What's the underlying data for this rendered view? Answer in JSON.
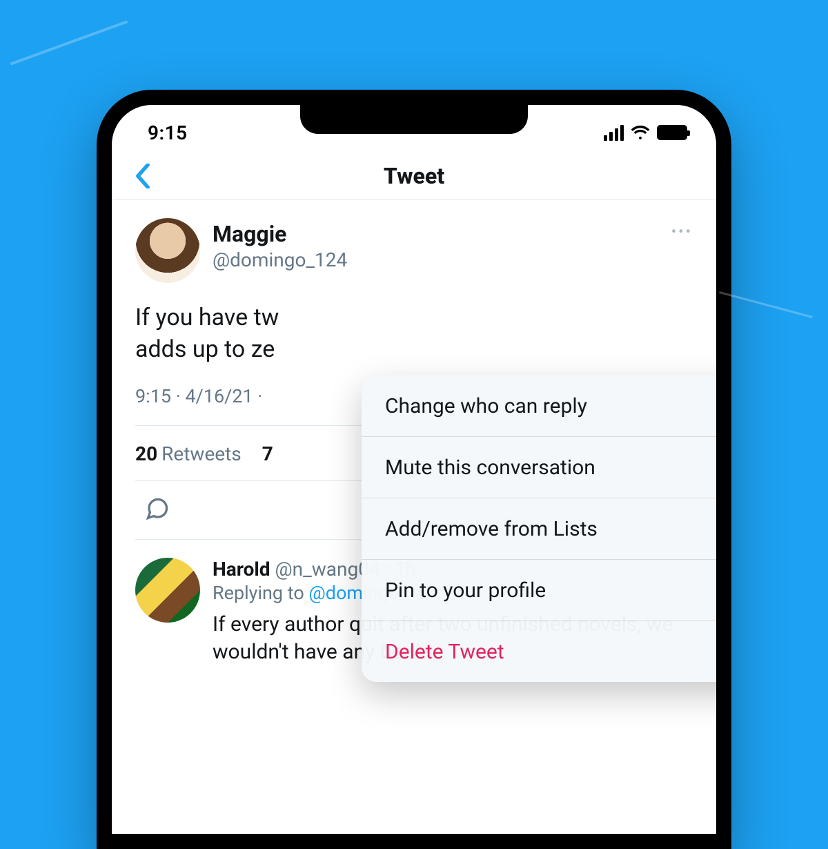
{
  "status": {
    "time": "9:15"
  },
  "nav": {
    "title": "Tweet"
  },
  "tweet": {
    "author_name": "Maggie",
    "author_handle": "@domingo_124",
    "body_line1": "If you have tw",
    "body_line2": "adds up to ze",
    "meta": "9:15 · 4/16/21 ·",
    "retweet_count": "20",
    "retweet_label": "Retweets",
    "quote_count_prefix": "7"
  },
  "menu": {
    "items": [
      {
        "label": "Change who can reply",
        "icon": "speech"
      },
      {
        "label": "Mute this conversation",
        "icon": "mute"
      },
      {
        "label": "Add/remove from Lists",
        "icon": "list"
      },
      {
        "label": "Pin to your profile",
        "icon": "pin"
      },
      {
        "label": "Delete Tweet",
        "icon": "trash"
      }
    ]
  },
  "reply": {
    "author_name": "Harold",
    "author_meta": "@n_wang04 · 1h",
    "replying_label": "Replying to ",
    "replying_handle": "@domingo_124",
    "body": "If every author quit after two unfinished novels, we wouldn't have any books."
  },
  "colors": {
    "accent": "#1DA1F2",
    "danger": "#e0245e"
  }
}
